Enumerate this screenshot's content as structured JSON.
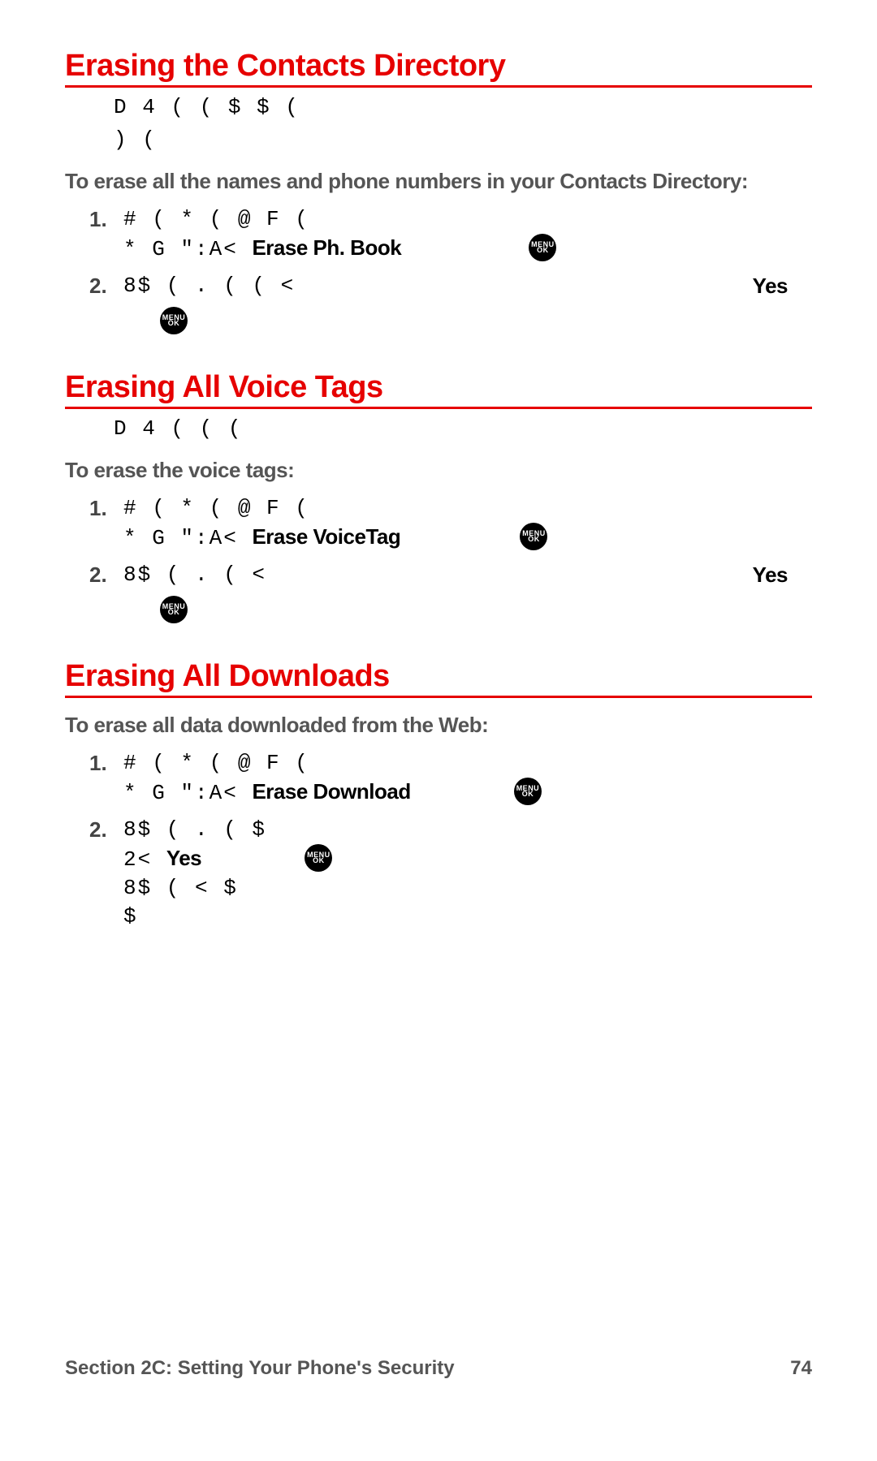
{
  "sections": [
    {
      "heading": "Erasing the Contacts Directory",
      "intro_lines": [
        "D   4 (        (        $            $ (",
        "  )       ("
      ],
      "sub_intro": "To erase all the names and phone numbers in your Contacts Directory:",
      "steps": [
        {
          "num": "1.",
          "line1_pre": "#              ( *         ( @    F                      (",
          "line2_pre": " *    G      \":A<               ",
          "line2_emph": "Erase Ph. Book",
          "line2_icon": true
        },
        {
          "num": "2.",
          "line1_pre": "8$ (  .       (              (           <",
          "line1_right_emph": "Yes",
          "trailing_icon": true
        }
      ]
    },
    {
      "heading": "Erasing All Voice Tags",
      "intro_lines": [
        "D   4 (        (                  ("
      ],
      "sub_intro": "To erase the voice tags:",
      "steps": [
        {
          "num": "1.",
          "line1_pre": "#              ( *         ( @    F                      (",
          "line2_pre": " *    G      \":A<               ",
          "line2_emph": "Erase VoiceTag",
          "line2_icon": true
        },
        {
          "num": "2.",
          "line1_pre": "8$ (  .       (                           <",
          "line1_right_emph": "Yes",
          "trailing_icon": true
        }
      ]
    },
    {
      "heading": "Erasing All Downloads",
      "intro_lines": [],
      "sub_intro": "To erase all data downloaded from the Web:",
      "steps": [
        {
          "num": "1.",
          "line1_pre": "#              ( *         ( @    F                      (",
          "line2_pre": " *    G      \":A<                  ",
          "line2_emph": "Erase Download",
          "line2_icon": true
        },
        {
          "num": "2.",
          "line1_pre": "8$ (  .       (                               $",
          "line2b_pre": "  2<           ",
          "line2b_emph": "Yes",
          "line2b_icon_after": true,
          "line3_pre": "   8$ (                             <    $",
          "line4_pre": "             $"
        }
      ]
    }
  ],
  "icon": {
    "top": "MENU",
    "bottom": "OK"
  },
  "footer": {
    "left": "Section 2C: Setting Your Phone's Security",
    "right": "74"
  }
}
